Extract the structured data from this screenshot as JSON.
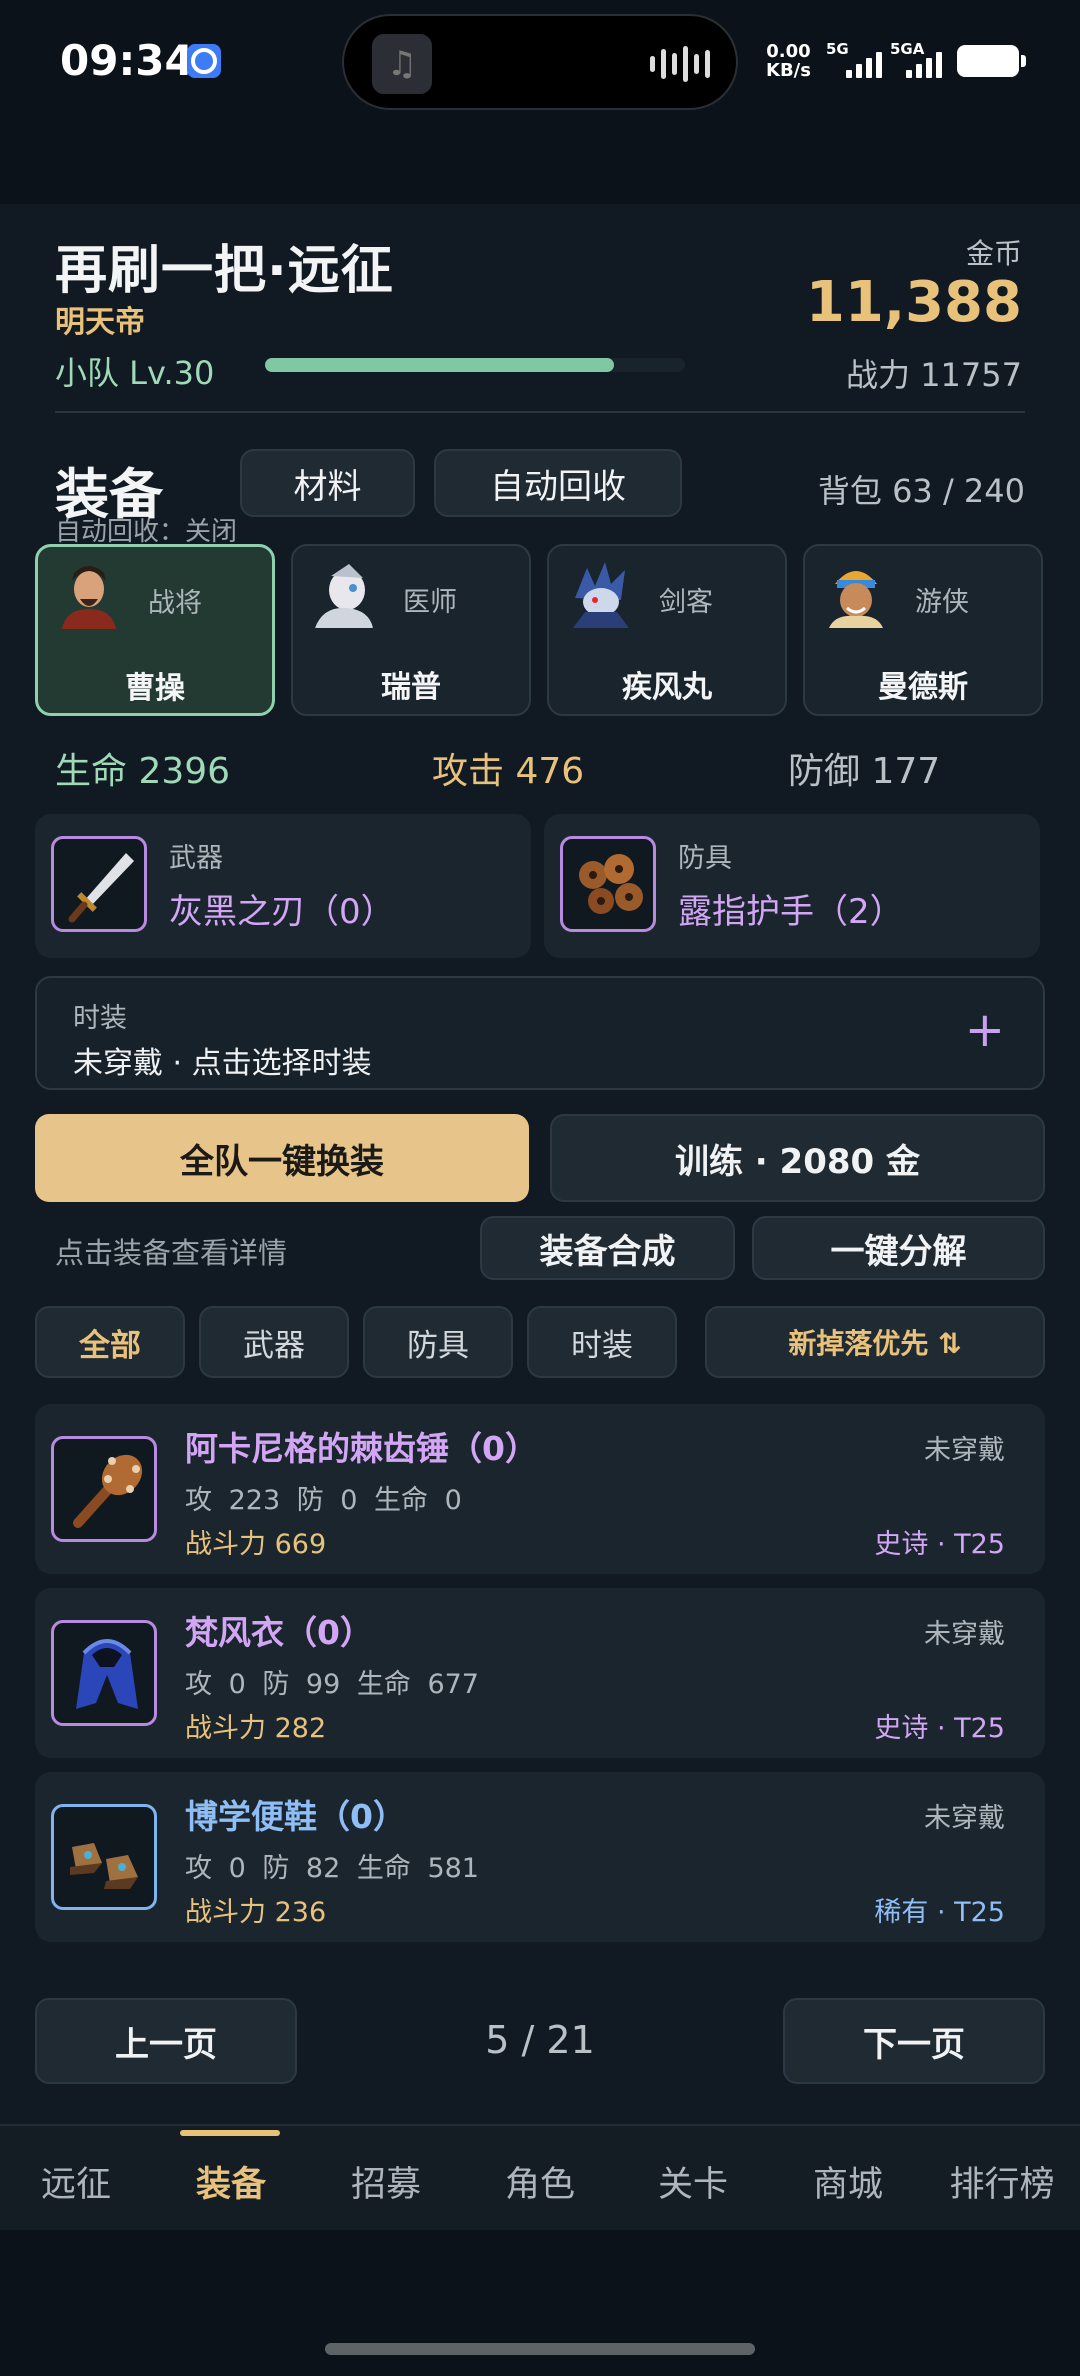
{
  "status_bar": {
    "time": "09:34",
    "net_speed_value": "0.00",
    "net_speed_unit": "KB/s",
    "sim1": "5G",
    "sim2": "5GA"
  },
  "header": {
    "title": "再刷一把·远征",
    "subtitle": "明天帝",
    "team_level": "小队 Lv.30",
    "xp_progress": 0.83,
    "gold_label": "金币",
    "gold_value": "11,388",
    "power": "战力 11757"
  },
  "equipment": {
    "section_title": "装备",
    "materials_button": "材料",
    "auto_recycle_button": "自动回收",
    "auto_recycle_status": "自动回收：关闭",
    "bag": "背包 63 / 240"
  },
  "heroes": [
    {
      "class": "战将",
      "name": "曹操",
      "selected": true
    },
    {
      "class": "医师",
      "name": "瑞普",
      "selected": false
    },
    {
      "class": "剑客",
      "name": "疾风丸",
      "selected": false
    },
    {
      "class": "游侠",
      "name": "曼德斯",
      "selected": false
    }
  ],
  "stats": {
    "hp": "生命 2396",
    "atk": "攻击 476",
    "def": "防御 177"
  },
  "slots": {
    "weapon": {
      "type": "武器",
      "name": "灰黑之刃（0）"
    },
    "armor": {
      "type": "防具",
      "name": "露指护手（2）"
    }
  },
  "costume": {
    "label": "时装",
    "text": "未穿戴 · 点击选择时装",
    "plus": "+"
  },
  "actions": {
    "team_equip": "全队一键换装",
    "train": "训练 · 2080 金",
    "hint": "点击装备查看详情",
    "synthesize": "装备合成",
    "decompose": "一键分解"
  },
  "filters": {
    "all": "全部",
    "weapon": "武器",
    "armor": "防具",
    "costume": "时装",
    "sort": "新掉落优先 ⇅"
  },
  "items": [
    {
      "name": "阿卡尼格的棘齿锤（0）",
      "stats": "攻 223  防 0  生命 0",
      "power": "战斗力 669",
      "worn": "未穿戴",
      "rarity": "史诗 · T25",
      "icon": "mace-icon"
    },
    {
      "name": "梵风衣（0）",
      "stats": "攻 0  防 99  生命 677",
      "power": "战斗力 282",
      "worn": "未穿戴",
      "rarity": "史诗 · T25",
      "icon": "cloak-icon"
    },
    {
      "name": "博学便鞋（0）",
      "stats": "攻 0  防 82  生命 581",
      "power": "战斗力 236",
      "worn": "未穿戴",
      "rarity": "稀有 · T25",
      "icon": "boots-icon"
    }
  ],
  "pagination": {
    "prev": "上一页",
    "indicator": "5 / 21",
    "next": "下一页"
  },
  "nav": [
    "远征",
    "装备",
    "招募",
    "角色",
    "关卡",
    "商城",
    "排行榜"
  ],
  "colors": {
    "accent_gold": "#e8c27a",
    "accent_green": "#8fd0ad",
    "epic": "#d2a6f5",
    "rare": "#8fbdf5"
  }
}
